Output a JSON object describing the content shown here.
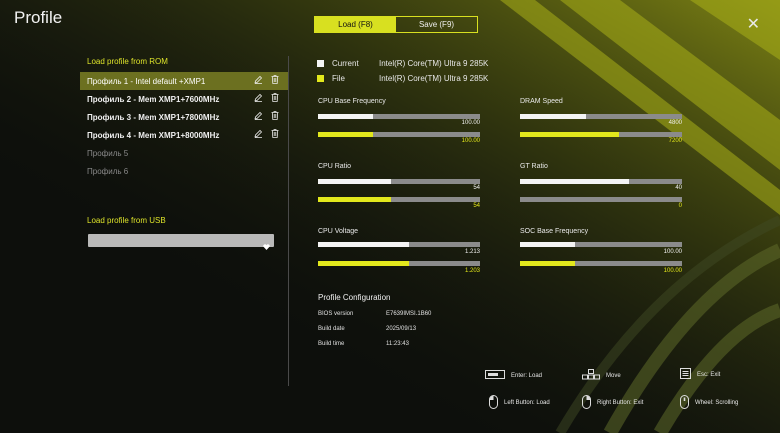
{
  "header": {
    "title": "Profile",
    "tabs": [
      {
        "label": "Load (F8)",
        "active": true
      },
      {
        "label": "Save (F9)",
        "active": false
      }
    ],
    "close_glyph": "✕"
  },
  "left": {
    "rom_heading": "Load profile from ROM",
    "profiles": [
      {
        "label": "Профиль 1 - Intel default +XMP1",
        "state": "selected"
      },
      {
        "label": "Профиль 2 - Mem XMP1+7600MHz",
        "state": "filled"
      },
      {
        "label": "Профиль 3 - Mem XMP1+7800MHz",
        "state": "filled"
      },
      {
        "label": "Профиль 4 - Mem XMP1+8000MHz",
        "state": "filled"
      },
      {
        "label": "Профиль 5",
        "state": "empty"
      },
      {
        "label": "Профиль 6",
        "state": "empty"
      }
    ],
    "usb_heading": "Load profile from USB",
    "usb_select_value": ""
  },
  "legend": {
    "current_label": "Current",
    "current_value": "Intel(R) Core(TM) Ultra 9 285K",
    "file_label": "File",
    "file_value": "Intel(R) Core(TM) Ultra 9 285K"
  },
  "metrics": [
    {
      "label": "CPU Base Frequency",
      "current": "100.00",
      "file": "100.00",
      "current_frac": 0.34,
      "file_frac": 0.34
    },
    {
      "label": "DRAM Speed",
      "current": "4800",
      "file": "7200",
      "current_frac": 0.41,
      "file_frac": 0.61
    },
    {
      "label": "CPU Ratio",
      "current": "54",
      "file": "54",
      "current_frac": 0.45,
      "file_frac": 0.45
    },
    {
      "label": "GT Ratio",
      "current": "40",
      "file": "0",
      "current_frac": 0.67,
      "file_frac": 0.0
    },
    {
      "label": "CPU Voltage",
      "current": "1.213",
      "file": "1.203",
      "current_frac": 0.56,
      "file_frac": 0.56
    },
    {
      "label": "SOC Base Frequency",
      "current": "100.00",
      "file": "100.00",
      "current_frac": 0.34,
      "file_frac": 0.34
    }
  ],
  "config": {
    "title": "Profile Configuration",
    "rows": [
      {
        "key": "BIOS version",
        "value": "E7639IMSI.1B60"
      },
      {
        "key": "Build date",
        "value": "2025/09/13"
      },
      {
        "key": "Build time",
        "value": "11:23:43"
      }
    ]
  },
  "hints": {
    "enter": "Enter: Load",
    "move": "Move",
    "esc": "Esc: Exit",
    "left_button": "Left Button: Load",
    "right_button": "Right Button: Exit",
    "wheel": "Wheel: Scrolling"
  },
  "colors": {
    "accent": "#dde32a",
    "selected_bg": "#6c7020"
  }
}
